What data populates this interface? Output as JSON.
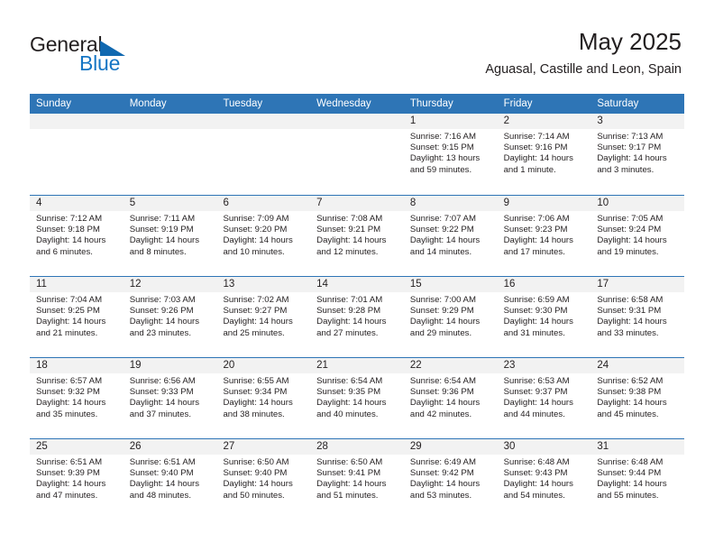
{
  "brand": {
    "name_part1": "General",
    "name_part2": "Blue",
    "triangle_color": "#1068b0",
    "blue_color": "#1575c4"
  },
  "header": {
    "title": "May 2025",
    "subtitle": "Aguasal, Castille and Leon, Spain"
  },
  "theme": {
    "header_blue": "#2e75b6",
    "day_band_gray": "#f2f2f2",
    "text": "#231f20"
  },
  "weekdays": [
    "Sunday",
    "Monday",
    "Tuesday",
    "Wednesday",
    "Thursday",
    "Friday",
    "Saturday"
  ],
  "weeks": [
    [
      {
        "day": "",
        "sunrise": "",
        "sunset": "",
        "daylight": "",
        "empty": true
      },
      {
        "day": "",
        "sunrise": "",
        "sunset": "",
        "daylight": "",
        "empty": true
      },
      {
        "day": "",
        "sunrise": "",
        "sunset": "",
        "daylight": "",
        "empty": true
      },
      {
        "day": "",
        "sunrise": "",
        "sunset": "",
        "daylight": "",
        "empty": true
      },
      {
        "day": "1",
        "sunrise": "Sunrise: 7:16 AM",
        "sunset": "Sunset: 9:15 PM",
        "daylight": "Daylight: 13 hours and 59 minutes."
      },
      {
        "day": "2",
        "sunrise": "Sunrise: 7:14 AM",
        "sunset": "Sunset: 9:16 PM",
        "daylight": "Daylight: 14 hours and 1 minute."
      },
      {
        "day": "3",
        "sunrise": "Sunrise: 7:13 AM",
        "sunset": "Sunset: 9:17 PM",
        "daylight": "Daylight: 14 hours and 3 minutes."
      }
    ],
    [
      {
        "day": "4",
        "sunrise": "Sunrise: 7:12 AM",
        "sunset": "Sunset: 9:18 PM",
        "daylight": "Daylight: 14 hours and 6 minutes."
      },
      {
        "day": "5",
        "sunrise": "Sunrise: 7:11 AM",
        "sunset": "Sunset: 9:19 PM",
        "daylight": "Daylight: 14 hours and 8 minutes."
      },
      {
        "day": "6",
        "sunrise": "Sunrise: 7:09 AM",
        "sunset": "Sunset: 9:20 PM",
        "daylight": "Daylight: 14 hours and 10 minutes."
      },
      {
        "day": "7",
        "sunrise": "Sunrise: 7:08 AM",
        "sunset": "Sunset: 9:21 PM",
        "daylight": "Daylight: 14 hours and 12 minutes."
      },
      {
        "day": "8",
        "sunrise": "Sunrise: 7:07 AM",
        "sunset": "Sunset: 9:22 PM",
        "daylight": "Daylight: 14 hours and 14 minutes."
      },
      {
        "day": "9",
        "sunrise": "Sunrise: 7:06 AM",
        "sunset": "Sunset: 9:23 PM",
        "daylight": "Daylight: 14 hours and 17 minutes."
      },
      {
        "day": "10",
        "sunrise": "Sunrise: 7:05 AM",
        "sunset": "Sunset: 9:24 PM",
        "daylight": "Daylight: 14 hours and 19 minutes."
      }
    ],
    [
      {
        "day": "11",
        "sunrise": "Sunrise: 7:04 AM",
        "sunset": "Sunset: 9:25 PM",
        "daylight": "Daylight: 14 hours and 21 minutes."
      },
      {
        "day": "12",
        "sunrise": "Sunrise: 7:03 AM",
        "sunset": "Sunset: 9:26 PM",
        "daylight": "Daylight: 14 hours and 23 minutes."
      },
      {
        "day": "13",
        "sunrise": "Sunrise: 7:02 AM",
        "sunset": "Sunset: 9:27 PM",
        "daylight": "Daylight: 14 hours and 25 minutes."
      },
      {
        "day": "14",
        "sunrise": "Sunrise: 7:01 AM",
        "sunset": "Sunset: 9:28 PM",
        "daylight": "Daylight: 14 hours and 27 minutes."
      },
      {
        "day": "15",
        "sunrise": "Sunrise: 7:00 AM",
        "sunset": "Sunset: 9:29 PM",
        "daylight": "Daylight: 14 hours and 29 minutes."
      },
      {
        "day": "16",
        "sunrise": "Sunrise: 6:59 AM",
        "sunset": "Sunset: 9:30 PM",
        "daylight": "Daylight: 14 hours and 31 minutes."
      },
      {
        "day": "17",
        "sunrise": "Sunrise: 6:58 AM",
        "sunset": "Sunset: 9:31 PM",
        "daylight": "Daylight: 14 hours and 33 minutes."
      }
    ],
    [
      {
        "day": "18",
        "sunrise": "Sunrise: 6:57 AM",
        "sunset": "Sunset: 9:32 PM",
        "daylight": "Daylight: 14 hours and 35 minutes."
      },
      {
        "day": "19",
        "sunrise": "Sunrise: 6:56 AM",
        "sunset": "Sunset: 9:33 PM",
        "daylight": "Daylight: 14 hours and 37 minutes."
      },
      {
        "day": "20",
        "sunrise": "Sunrise: 6:55 AM",
        "sunset": "Sunset: 9:34 PM",
        "daylight": "Daylight: 14 hours and 38 minutes."
      },
      {
        "day": "21",
        "sunrise": "Sunrise: 6:54 AM",
        "sunset": "Sunset: 9:35 PM",
        "daylight": "Daylight: 14 hours and 40 minutes."
      },
      {
        "day": "22",
        "sunrise": "Sunrise: 6:54 AM",
        "sunset": "Sunset: 9:36 PM",
        "daylight": "Daylight: 14 hours and 42 minutes."
      },
      {
        "day": "23",
        "sunrise": "Sunrise: 6:53 AM",
        "sunset": "Sunset: 9:37 PM",
        "daylight": "Daylight: 14 hours and 44 minutes."
      },
      {
        "day": "24",
        "sunrise": "Sunrise: 6:52 AM",
        "sunset": "Sunset: 9:38 PM",
        "daylight": "Daylight: 14 hours and 45 minutes."
      }
    ],
    [
      {
        "day": "25",
        "sunrise": "Sunrise: 6:51 AM",
        "sunset": "Sunset: 9:39 PM",
        "daylight": "Daylight: 14 hours and 47 minutes."
      },
      {
        "day": "26",
        "sunrise": "Sunrise: 6:51 AM",
        "sunset": "Sunset: 9:40 PM",
        "daylight": "Daylight: 14 hours and 48 minutes."
      },
      {
        "day": "27",
        "sunrise": "Sunrise: 6:50 AM",
        "sunset": "Sunset: 9:40 PM",
        "daylight": "Daylight: 14 hours and 50 minutes."
      },
      {
        "day": "28",
        "sunrise": "Sunrise: 6:50 AM",
        "sunset": "Sunset: 9:41 PM",
        "daylight": "Daylight: 14 hours and 51 minutes."
      },
      {
        "day": "29",
        "sunrise": "Sunrise: 6:49 AM",
        "sunset": "Sunset: 9:42 PM",
        "daylight": "Daylight: 14 hours and 53 minutes."
      },
      {
        "day": "30",
        "sunrise": "Sunrise: 6:48 AM",
        "sunset": "Sunset: 9:43 PM",
        "daylight": "Daylight: 14 hours and 54 minutes."
      },
      {
        "day": "31",
        "sunrise": "Sunrise: 6:48 AM",
        "sunset": "Sunset: 9:44 PM",
        "daylight": "Daylight: 14 hours and 55 minutes."
      }
    ]
  ]
}
